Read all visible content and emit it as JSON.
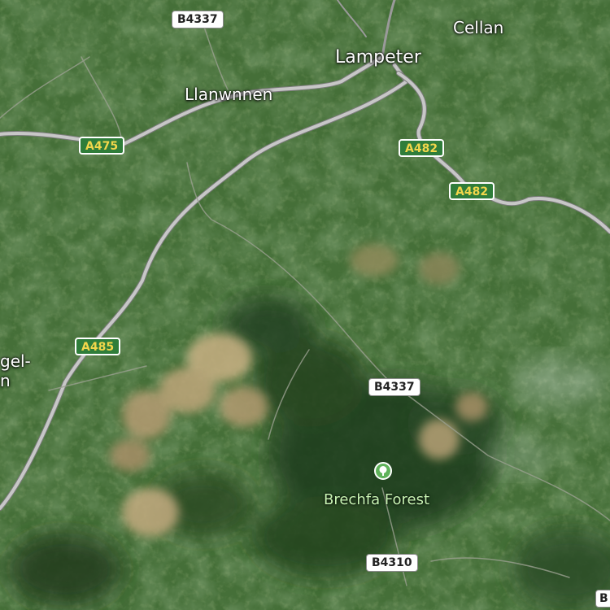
{
  "places": {
    "lampeter": "Lampeter",
    "cellan": "Cellan",
    "llanwnnen": "Llanwnnen",
    "partial_left": "gel-\nn"
  },
  "roads": {
    "a475": "A475",
    "a482_1": "A482",
    "a482_2": "A482",
    "a485": "A485",
    "b4337_top": "B4337",
    "b4337_mid": "B4337",
    "b4310": "B4310",
    "b_edge": "B"
  },
  "poi": {
    "label": "Brechfa Forest",
    "icon": "tree-icon"
  },
  "colors": {
    "primary_shield_bg": "#2f7d3a",
    "primary_shield_text": "#f2d64b",
    "poi_label": "#c9f5b4",
    "road": "#b8b8b8"
  }
}
